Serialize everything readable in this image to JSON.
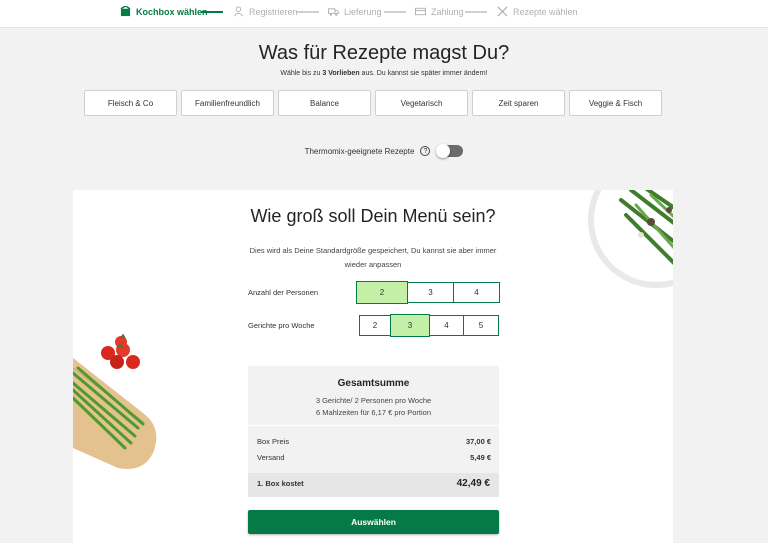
{
  "colors": {
    "brand": "#067a46",
    "selected": "#c3f0a6"
  },
  "steps": [
    {
      "label": "Kochbox wählen",
      "icon": "box-icon",
      "active": true
    },
    {
      "label": "Registrieren",
      "icon": "user-icon",
      "active": false
    },
    {
      "label": "Lieferung",
      "icon": "truck-icon",
      "active": false
    },
    {
      "label": "Zahlung",
      "icon": "card-icon",
      "active": false
    },
    {
      "label": "Rezepte wählen",
      "icon": "cutlery-icon",
      "active": false
    }
  ],
  "preferences": {
    "title": "Was für Rezepte magst Du?",
    "subtitle_pre": "Wähle bis zu ",
    "subtitle_bold": "3 Vorlieben",
    "subtitle_post": " aus. Du kannst sie später immer ändern!",
    "options": [
      "Fleisch & Co",
      "Familienfreundlich",
      "Balance",
      "Vegetarisch",
      "Zeit sparen",
      "Veggie & Fisch"
    ],
    "thermomix_label": "Thermomix-geeignete Rezepte",
    "thermomix_help": "?",
    "thermomix_enabled": false
  },
  "menu": {
    "title": "Wie groß soll Dein Menü sein?",
    "description": "Dies wird als Deine Standardgröße gespeichert, Du kannst sie aber immer wieder anpassen",
    "persons_label": "Anzahl der Personen",
    "persons_options": [
      "2",
      "3",
      "4"
    ],
    "persons_selected": "2",
    "meals_label": "Gerichte pro Woche",
    "meals_options": [
      "2",
      "3",
      "4",
      "5"
    ],
    "meals_selected": "3"
  },
  "summary": {
    "title": "Gesamtsumme",
    "line1": "3 Gerichte/ 2 Personen pro Woche",
    "line2": "6 Mahlzeiten für 6,17 € pro Portion",
    "box_price_label": "Box Preis",
    "box_price_value": "37,00 €",
    "shipping_label": "Versand",
    "shipping_value": "5,49 €",
    "total_label": "1. Box kostet",
    "total_value": "42,49 €"
  },
  "cta_label": "Auswählen"
}
